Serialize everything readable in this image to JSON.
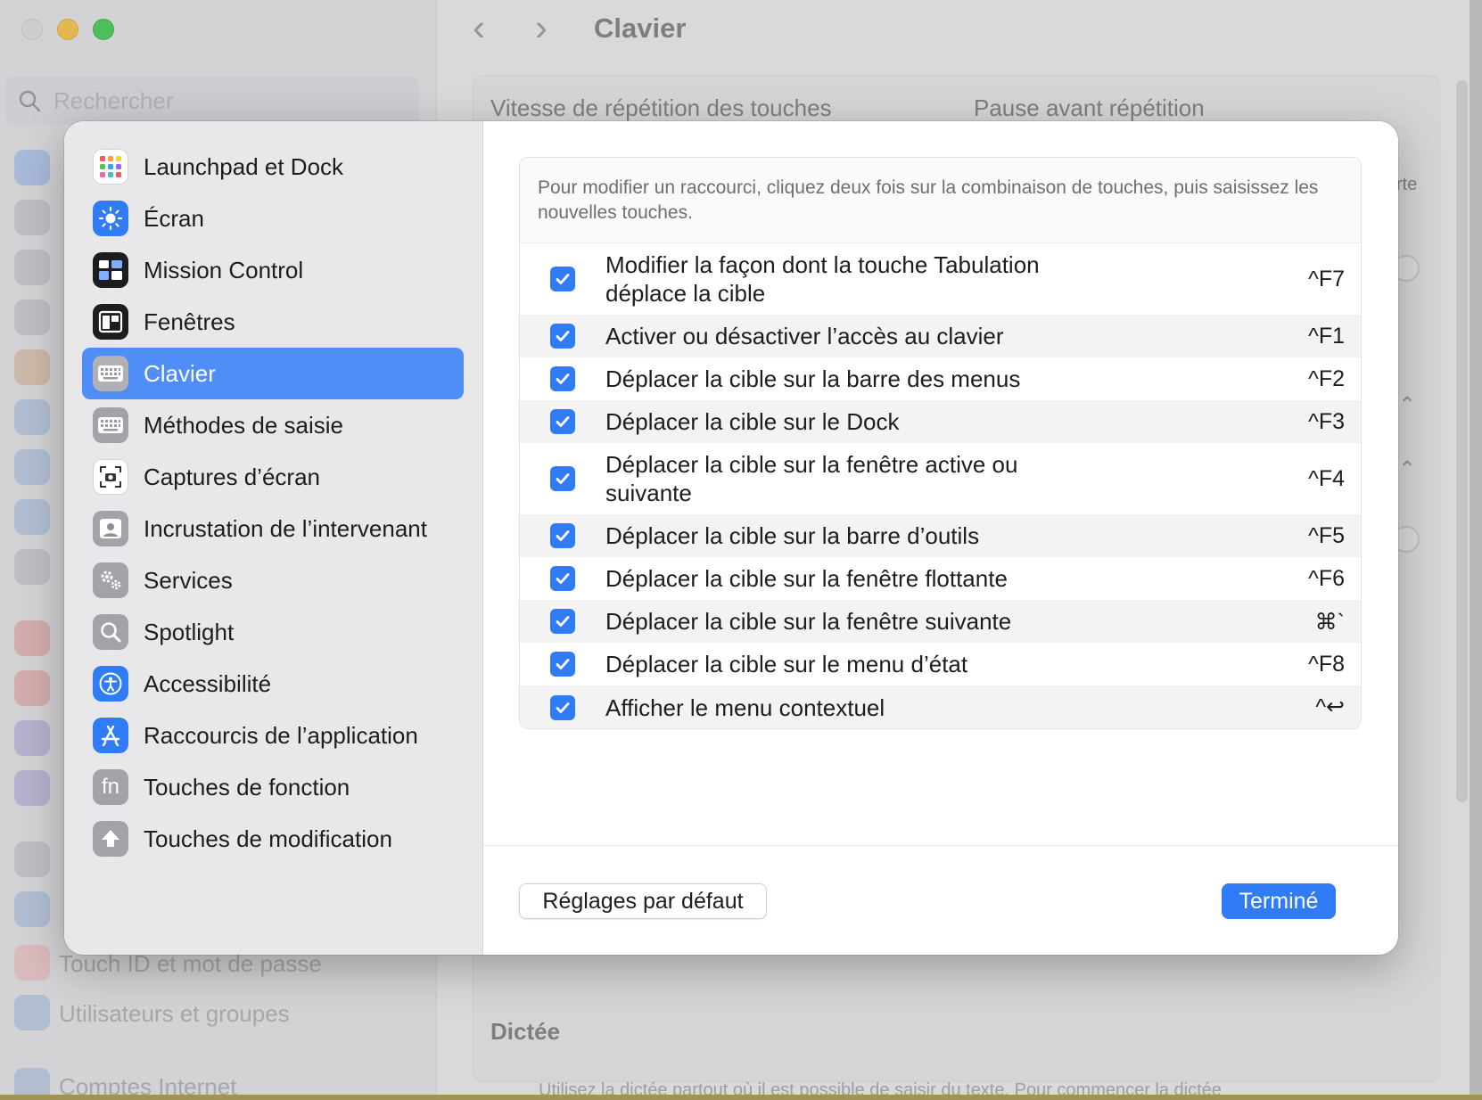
{
  "background": {
    "search_placeholder": "Rechercher",
    "title": "Clavier",
    "repeat_speed_label": "Vitesse de répétition des touches",
    "repeat_delay_label": "Pause avant répétition",
    "partial_text_right": "rte",
    "dictation_title": "Dictée",
    "dictation_hint": "Utilisez la dictée partout où il est possible de saisir du texte. Pour commencer la dictée",
    "sidebar_items": [
      {
        "label": "Touch ID et mot de passe",
        "icon": "fingerprint-icon"
      },
      {
        "label": "Utilisateurs et groupes",
        "icon": "users-icon"
      },
      {
        "label": "Comptes Internet",
        "icon": "at-icon"
      }
    ]
  },
  "sheet": {
    "sidebar": {
      "selected": "Clavier",
      "items": [
        {
          "label": "Launchpad et Dock",
          "icon": "launchpad-icon",
          "color": "#ffffff"
        },
        {
          "label": "Écran",
          "icon": "sun-icon",
          "color": "#2f7cf6"
        },
        {
          "label": "Mission Control",
          "icon": "mission-control-icon",
          "color": "#1d1d1f"
        },
        {
          "label": "Fenêtres",
          "icon": "windows-icon",
          "color": "#1d1d1f"
        },
        {
          "label": "Clavier",
          "icon": "keyboard-icon",
          "color": "#9a9aa0"
        },
        {
          "label": "Méthodes de saisie",
          "icon": "keyboard-icon",
          "color": "#9a9aa0"
        },
        {
          "label": "Captures d’écran",
          "icon": "screenshot-icon",
          "color": "#ffffff"
        },
        {
          "label": "Incrustation de l’intervenant",
          "icon": "presenter-icon",
          "color": "#9a9aa0"
        },
        {
          "label": "Services",
          "icon": "gears-icon",
          "color": "#9a9aa0"
        },
        {
          "label": "Spotlight",
          "icon": "magnifier-icon",
          "color": "#9a9aa0"
        },
        {
          "label": "Accessibilité",
          "icon": "accessibility-icon",
          "color": "#2f7cf6"
        },
        {
          "label": "Raccourcis de l’application",
          "icon": "app-store-icon",
          "color": "#2f7cf6"
        },
        {
          "label": "Touches de fonction",
          "icon": "fn-icon",
          "color": "#9a9aa0",
          "glyph": "fn"
        },
        {
          "label": "Touches de modification",
          "icon": "up-arrow-icon",
          "color": "#9a9aa0"
        }
      ]
    },
    "description": "Pour modifier un raccourci, cliquez deux fois sur la combinaison de touches, puis saisissez les nouvelles touches.",
    "shortcuts": [
      {
        "label": "Modifier la façon dont la touche Tabulation déplace la cible",
        "key": "^F7",
        "checked": true
      },
      {
        "label": "Activer ou désactiver l’accès au clavier",
        "key": "^F1",
        "checked": true
      },
      {
        "label": "Déplacer la cible sur la barre des menus",
        "key": "^F2",
        "checked": true
      },
      {
        "label": "Déplacer la cible sur le Dock",
        "key": "^F3",
        "checked": true
      },
      {
        "label": "Déplacer la cible sur la fenêtre active ou suivante",
        "key": "^F4",
        "checked": true
      },
      {
        "label": "Déplacer la cible sur la barre d’outils",
        "key": "^F5",
        "checked": true
      },
      {
        "label": "Déplacer la cible sur la fenêtre flottante",
        "key": "^F6",
        "checked": true
      },
      {
        "label": "Déplacer la cible sur la fenêtre suivante",
        "key": "⌘`",
        "checked": true
      },
      {
        "label": "Déplacer la cible sur le menu d’état",
        "key": "^F8",
        "checked": true
      },
      {
        "label": "Afficher le menu contextuel",
        "key": "^↩",
        "checked": true
      }
    ],
    "buttons": {
      "defaults": "Réglages par défaut",
      "done": "Terminé"
    },
    "colors": {
      "accent": "#2f7cf6",
      "selection": "#4f8ef7"
    }
  }
}
